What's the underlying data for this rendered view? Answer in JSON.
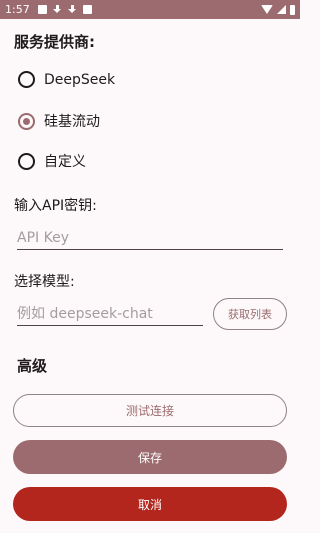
{
  "status_bar": {
    "time": "1:57",
    "icons": [
      "image-icon",
      "download-icon",
      "download-icon",
      "font-icon"
    ],
    "right_icons": [
      "wifi-icon",
      "signal-icon",
      "battery-icon"
    ]
  },
  "provider": {
    "label": "服务提供商:",
    "options": [
      {
        "label": "DeepSeek",
        "checked": false
      },
      {
        "label": "硅基流动",
        "checked": true
      },
      {
        "label": "自定义",
        "checked": false
      }
    ]
  },
  "api_key": {
    "label": "输入API密钥:",
    "placeholder": "API Key",
    "value": ""
  },
  "model": {
    "label": "选择模型:",
    "placeholder": "例如 deepseek-chat",
    "value": "",
    "fetch_button": "获取列表"
  },
  "advanced": {
    "label": "高级"
  },
  "buttons": {
    "test": "测试连接",
    "save": "保存",
    "cancel": "取消"
  },
  "colors": {
    "primary": "#9c6b6f",
    "error": "#b3261e",
    "background": "#fdf8f9"
  }
}
